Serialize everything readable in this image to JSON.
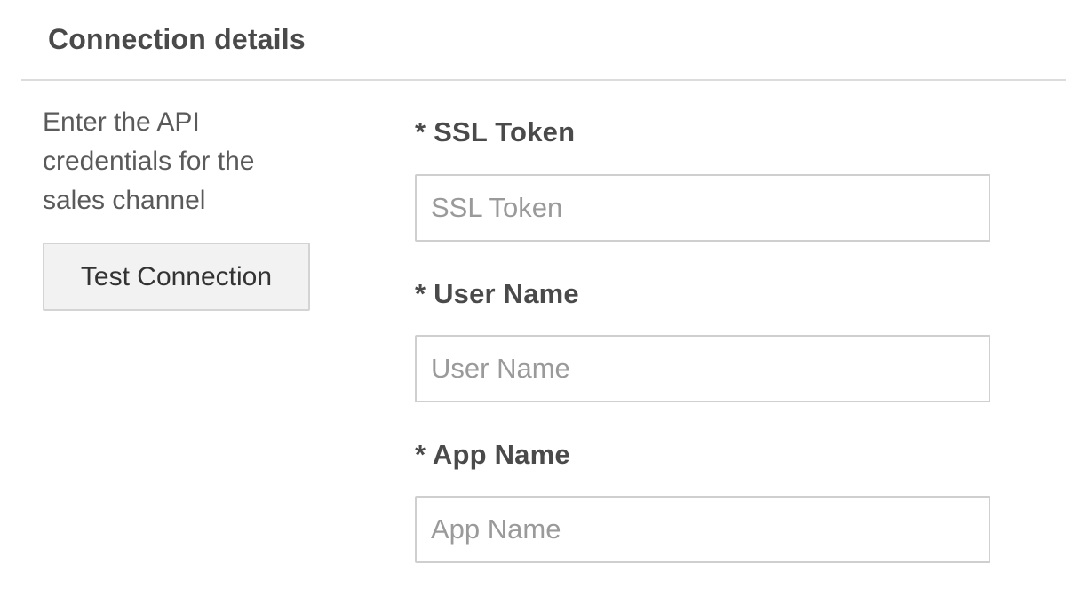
{
  "section": {
    "title": "Connection details"
  },
  "sidebar": {
    "description": "Enter the API credentials for the sales channel",
    "test_button_label": "Test Connection"
  },
  "fields": [
    {
      "label": "* SSL Token",
      "placeholder": "SSL Token",
      "value": ""
    },
    {
      "label": "* User Name",
      "placeholder": "User Name",
      "value": ""
    },
    {
      "label": "* App Name",
      "placeholder": "App Name",
      "value": ""
    }
  ]
}
